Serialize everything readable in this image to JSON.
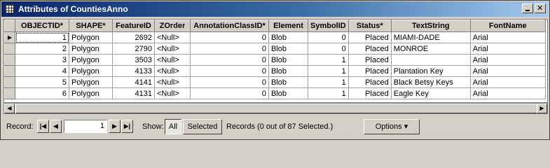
{
  "window": {
    "title": "Attributes of CountiesAnno"
  },
  "table": {
    "columns": [
      "OBJECTID*",
      "SHAPE*",
      "FeatureID",
      "ZOrder",
      "AnnotationClassID*",
      "Element",
      "SymbolID",
      "Status*",
      "TextString",
      "FontName"
    ],
    "rows": [
      [
        "1",
        "Polygon",
        "2692",
        "<Null>",
        "0",
        "Blob",
        "0",
        "Placed",
        "MIAMI-DADE",
        "Arial"
      ],
      [
        "2",
        "Polygon",
        "2790",
        "<Null>",
        "0",
        "Blob",
        "0",
        "Placed",
        "MONROE",
        "Arial"
      ],
      [
        "3",
        "Polygon",
        "3503",
        "<Null>",
        "0",
        "Blob",
        "1",
        "Placed",
        "",
        "Arial"
      ],
      [
        "4",
        "Polygon",
        "4133",
        "<Null>",
        "0",
        "Blob",
        "1",
        "Placed",
        "Plantation Key",
        "Arial"
      ],
      [
        "5",
        "Polygon",
        "4141",
        "<Null>",
        "0",
        "Blob",
        "1",
        "Placed",
        "Black Betsy Keys",
        "Arial"
      ],
      [
        "6",
        "Polygon",
        "4131",
        "<Null>",
        "0",
        "Blob",
        "1",
        "Placed",
        "Eagle Key",
        "Arial"
      ]
    ],
    "current_row_marker": "▶"
  },
  "bottom": {
    "record_label": "Record:",
    "record_value": "1",
    "show_label": "Show:",
    "all_label": "All",
    "selected_label": "Selected",
    "records_text": "Records  (0 out of 87 Selected.)",
    "options_label": "Options",
    "options_arrow": "▾",
    "nav_first": "|◀",
    "nav_prev": "◀",
    "nav_next": "▶",
    "nav_last": "▶|"
  }
}
